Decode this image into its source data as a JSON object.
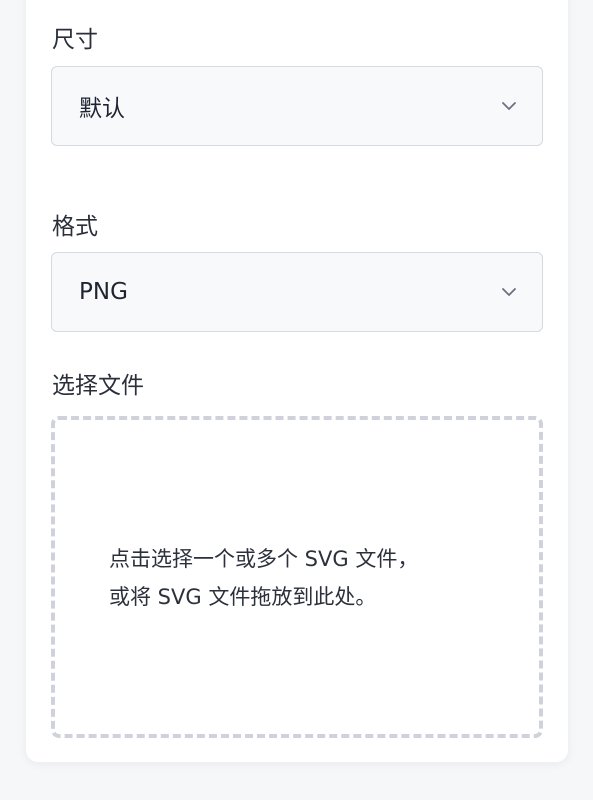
{
  "size": {
    "label": "尺寸",
    "value": "默认"
  },
  "format": {
    "label": "格式",
    "value": "PNG"
  },
  "file": {
    "label": "选择文件",
    "hint_line1": "点击选择一个或多个 SVG 文件，",
    "hint_line2": "或将 SVG 文件拖放到此处。"
  },
  "icons": {
    "dropdown": "chevron-down-icon"
  },
  "colors": {
    "border": "#d5d9e0",
    "dashed_border": "#cfd2db",
    "select_bg": "#f8f9fb",
    "text": "#1f2430"
  }
}
